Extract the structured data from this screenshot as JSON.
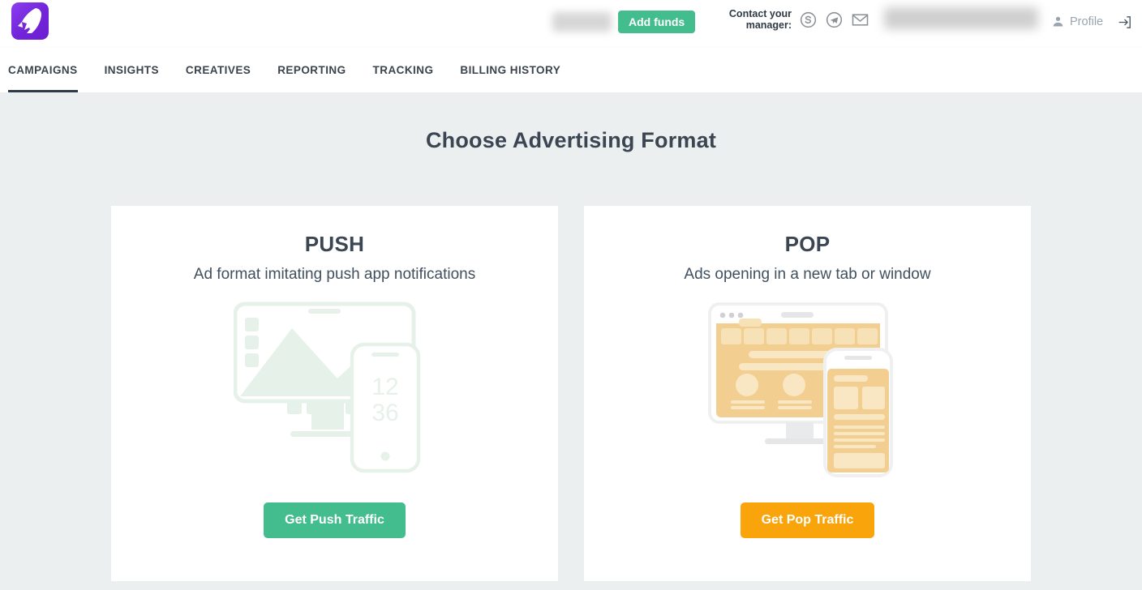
{
  "brand": {
    "logo_icon": "rocket-logo-icon",
    "logo_color": "#7324d8"
  },
  "header": {
    "balance_masked": "",
    "add_funds_label": "Add funds",
    "contact_label_line1": "Contact your",
    "contact_label_line2": "manager:",
    "contact_icons": [
      {
        "name": "skype-icon",
        "glyph": "S"
      },
      {
        "name": "telegram-icon",
        "glyph": "➤"
      },
      {
        "name": "email-icon",
        "glyph": "✉"
      }
    ],
    "user_masked": "",
    "profile_label": "Profile",
    "profile_icon": "person-icon",
    "logout_icon": "logout-icon"
  },
  "nav": {
    "active_index": 0,
    "items": [
      {
        "label": "CAMPAIGNS"
      },
      {
        "label": "INSIGHTS"
      },
      {
        "label": "CREATIVES"
      },
      {
        "label": "REPORTING"
      },
      {
        "label": "TRACKING"
      },
      {
        "label": "BILLING HISTORY"
      }
    ]
  },
  "main": {
    "page_title": "Choose Advertising Format",
    "cards": [
      {
        "id": "push",
        "title": "PUSH",
        "subtitle": "Ad format imitating push app notifications",
        "illustration": "monitor-and-phone-push-illustration",
        "phone_time_top": "12",
        "phone_time_bottom": "36",
        "button_label": "Get Push Traffic",
        "button_color": "#43bd8d",
        "art_color": "#e6f1ea"
      },
      {
        "id": "pop",
        "title": "POP",
        "subtitle": "Ads opening in a new tab or window",
        "illustration": "browser-and-phone-pop-illustration",
        "button_label": "Get Pop Traffic",
        "button_color": "#f9a40b",
        "art_color": "#f2cf90"
      }
    ]
  },
  "colors": {
    "page_background": "#eceff0",
    "surface": "#ffffff",
    "text_primary": "#3b4652",
    "accent_green": "#43bd8d",
    "accent_orange": "#f9a40b",
    "nav_active_underline": "#2f3a4a"
  }
}
